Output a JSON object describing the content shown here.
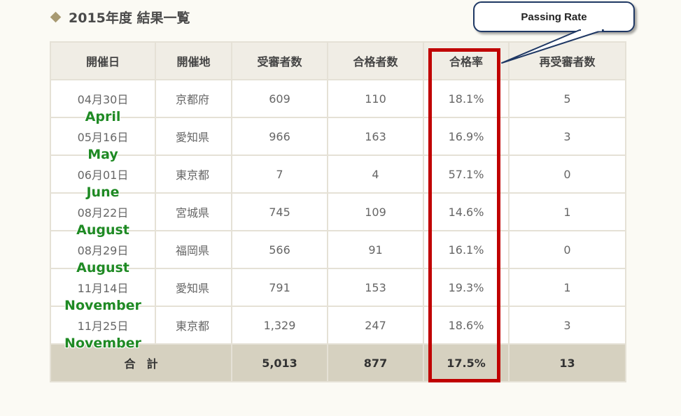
{
  "page": {
    "title": "2015年度 結果一覧",
    "accent_color": "#a89a72",
    "icon": "diamond-bullet-icon"
  },
  "table": {
    "columns": [
      "開催日",
      "開催地",
      "受審者数",
      "合格者数",
      "合格率",
      "再受審者数"
    ],
    "rows": [
      {
        "date": "04月30日",
        "location": "京都府",
        "examinees": "609",
        "passed": "110",
        "rate": "18.1%",
        "retakers": "5",
        "month": "April"
      },
      {
        "date": "05月16日",
        "location": "愛知県",
        "examinees": "966",
        "passed": "163",
        "rate": "16.9%",
        "retakers": "3",
        "month": "May"
      },
      {
        "date": "06月01日",
        "location": "東京都",
        "examinees": "7",
        "passed": "4",
        "rate": "57.1%",
        "retakers": "0",
        "month": "June"
      },
      {
        "date": "08月22日",
        "location": "宮城県",
        "examinees": "745",
        "passed": "109",
        "rate": "14.6%",
        "retakers": "1",
        "month": "August"
      },
      {
        "date": "08月29日",
        "location": "福岡県",
        "examinees": "566",
        "passed": "91",
        "rate": "16.1%",
        "retakers": "0",
        "month": "August"
      },
      {
        "date": "11月14日",
        "location": "愛知県",
        "examinees": "791",
        "passed": "153",
        "rate": "19.3%",
        "retakers": "1",
        "month": "November"
      },
      {
        "date": "11月25日",
        "location": "東京都",
        "examinees": "1,329",
        "passed": "247",
        "rate": "18.6%",
        "retakers": "3",
        "month": "November"
      }
    ],
    "total": {
      "label": "合　計",
      "examinees": "5,013",
      "passed": "877",
      "rate": "17.5%",
      "retakers": "13"
    }
  },
  "annotation": {
    "callout_text": "Passing Rate",
    "highlight_color": "#c00000",
    "month_label_color": "#1f8a24"
  }
}
